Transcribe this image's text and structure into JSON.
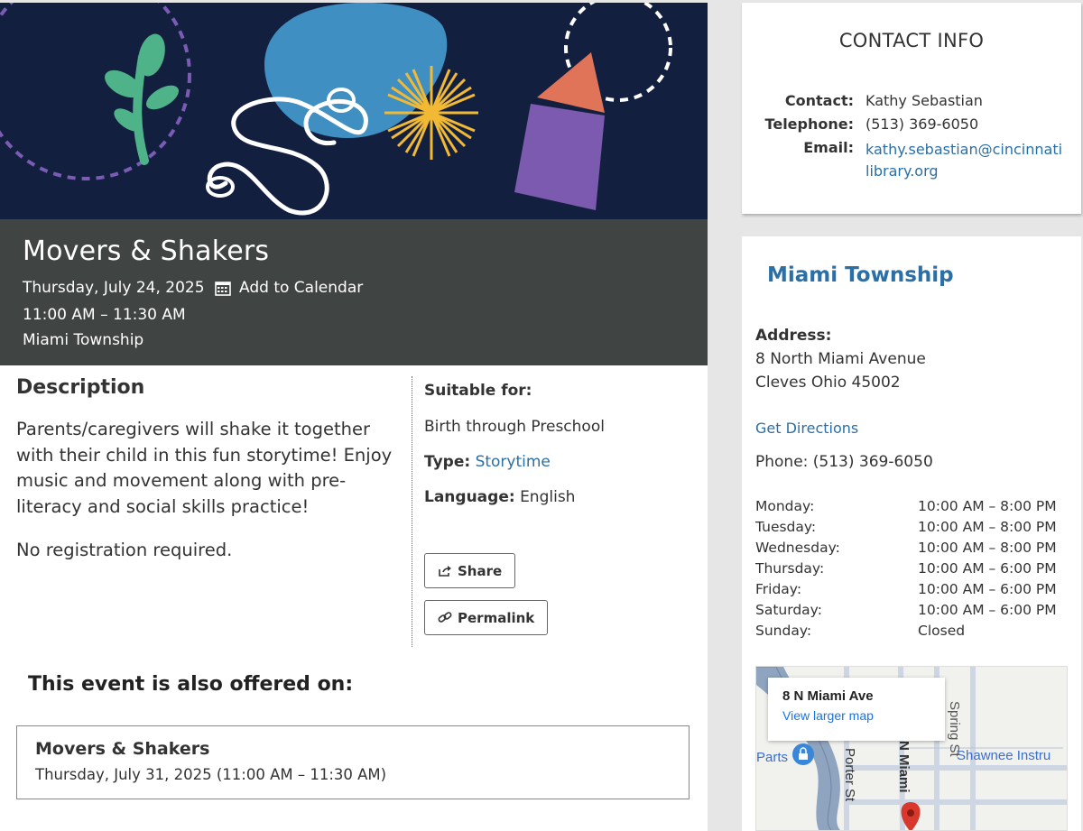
{
  "event": {
    "title": "Movers & Shakers",
    "date": "Thursday, July 24, 2025",
    "add_to_calendar": "Add to Calendar",
    "time": "11:00 AM – 11:30 AM",
    "location": "Miami Township"
  },
  "description": {
    "heading": "Description",
    "body": "Parents/caregivers will shake it together with their child in this fun storytime!  Enjoy music and movement along with pre-literacy and social skills practice!",
    "registration": "No registration required."
  },
  "details": {
    "suitable_label": "Suitable for:",
    "suitable_value": "Birth through Preschool",
    "type_label": "Type:",
    "type_value": "Storytime",
    "language_label": "Language:",
    "language_value": "English",
    "share_label": "Share",
    "permalink_label": "Permalink"
  },
  "also_offered": {
    "heading": "This event is also offered on:",
    "items": [
      {
        "title": "Movers & Shakers",
        "date": "Thursday, July 31, 2025 (11:00 AM – 11:30 AM)"
      }
    ]
  },
  "contact": {
    "heading": "CONTACT INFO",
    "contact_label": "Contact:",
    "contact_value": "Kathy Sebastian",
    "telephone_label": "Telephone:",
    "telephone_value": "(513) 369-6050",
    "email_label": "Email:",
    "email_value": "kathy.sebastian@cincinnatilibrary.org"
  },
  "branch": {
    "name": "Miami Township",
    "address_label": "Address:",
    "address_line1": "8 North Miami Avenue",
    "address_line2": "Cleves Ohio 45002",
    "directions": "Get Directions",
    "phone": "Phone: (513) 369-6050",
    "hours": [
      {
        "day": "Monday:",
        "hours": "10:00 AM – 8:00 PM"
      },
      {
        "day": "Tuesday:",
        "hours": "10:00 AM – 8:00 PM"
      },
      {
        "day": "Wednesday:",
        "hours": "10:00 AM – 8:00 PM"
      },
      {
        "day": "Thursday:",
        "hours": "10:00 AM – 6:00 PM"
      },
      {
        "day": "Friday:",
        "hours": "10:00 AM – 6:00 PM"
      },
      {
        "day": "Saturday:",
        "hours": "10:00 AM – 6:00 PM"
      },
      {
        "day": "Sunday:",
        "hours": "Closed"
      }
    ]
  },
  "map": {
    "address": "8 N Miami Ave",
    "larger_map": "View larger map",
    "labels": {
      "spring": "Spring St",
      "porter": "Porter St",
      "miami": "N Miami",
      "parts": "Parts",
      "shawnee": "Shawnee Instru"
    }
  },
  "colors": {
    "banner_bg": "#131f3f",
    "header_bg": "#404443",
    "link": "#2a6fa5"
  }
}
